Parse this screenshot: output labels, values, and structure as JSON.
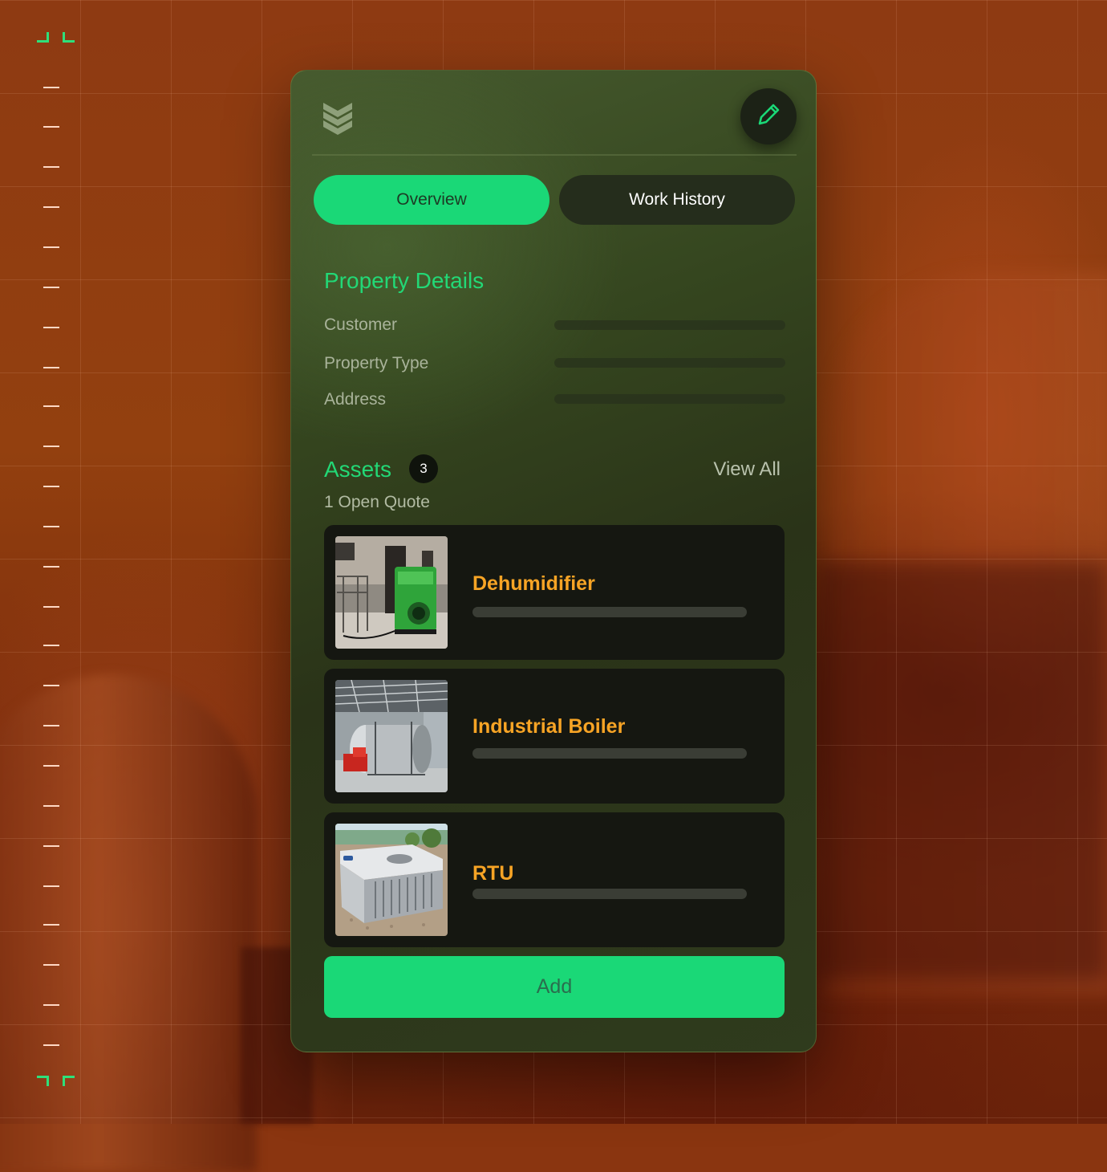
{
  "tabs": {
    "overview": "Overview",
    "work_history": "Work History"
  },
  "property_details": {
    "title": "Property Details",
    "fields": [
      "Customer",
      "Property Type",
      "Address"
    ]
  },
  "assets": {
    "title": "Assets",
    "count": "3",
    "view_all": "View All",
    "subtitle": "1 Open Quote",
    "items": [
      {
        "name": "Dehumidifier"
      },
      {
        "name": "Industrial Boiler"
      },
      {
        "name": "RTU"
      }
    ]
  },
  "add_button": "Add",
  "icons": {
    "logo": "stacked-chevrons-logo-icon",
    "edit": "pencil-icon"
  },
  "colors": {
    "accent_green": "#1ad877",
    "asset_name": "#f7a425",
    "card_dark": "#151711"
  }
}
